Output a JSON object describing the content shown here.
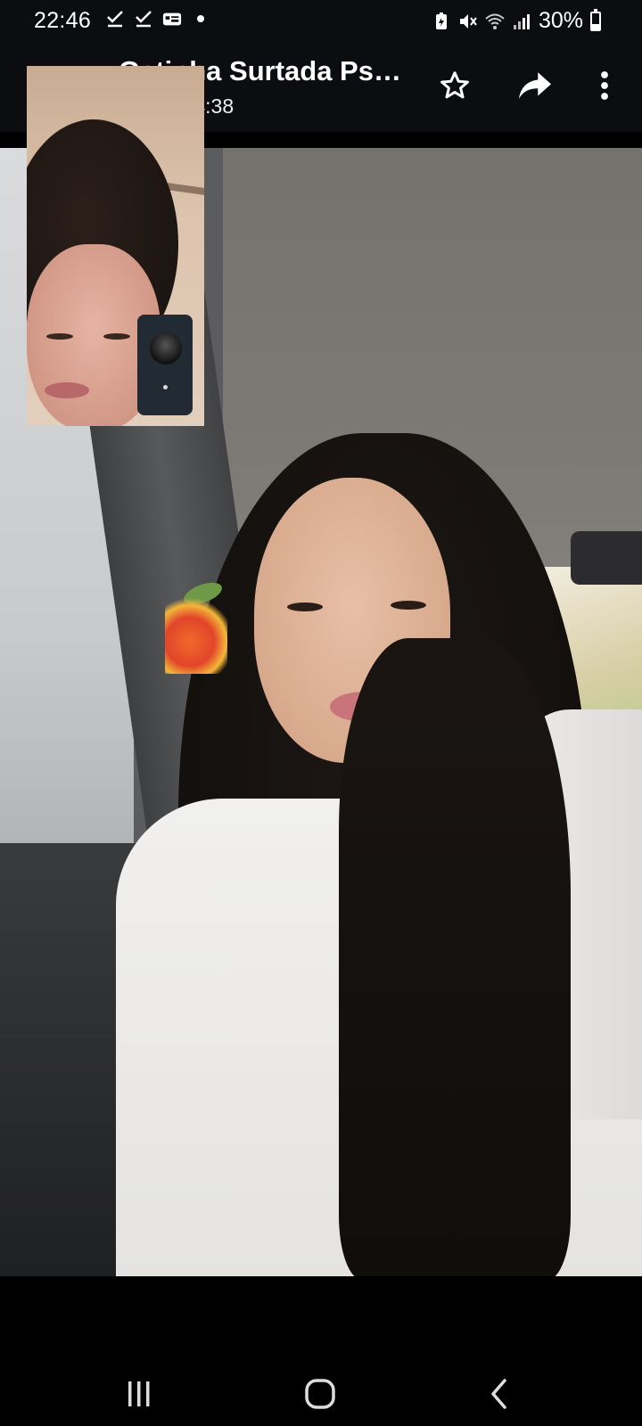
{
  "status_bar": {
    "time": "22:46",
    "left_icons": [
      "check-icon",
      "check-icon",
      "app-notification-icon",
      "dot-icon"
    ],
    "right_icons": [
      "battery-saver-icon",
      "mute-icon",
      "wifi-icon",
      "signal-icon"
    ],
    "battery_text": "30%",
    "battery_level": 0.3
  },
  "header": {
    "title": "Gatinha Surtada Ps…",
    "subtitle": "embro 14:38",
    "star_icon": "star-outline-icon",
    "share_icon": "share-forward-icon",
    "more_icon": "more-vertical-icon"
  },
  "call": {
    "remote_video_label": "",
    "self_view_label": ""
  },
  "nav_bar": {
    "recents_icon": "recents-icon",
    "home_icon": "home-icon",
    "back_icon": "back-icon"
  },
  "colors": {
    "bar_background": "#0b0d10",
    "text": "#ffffff",
    "pip_panel": "#222a33"
  }
}
